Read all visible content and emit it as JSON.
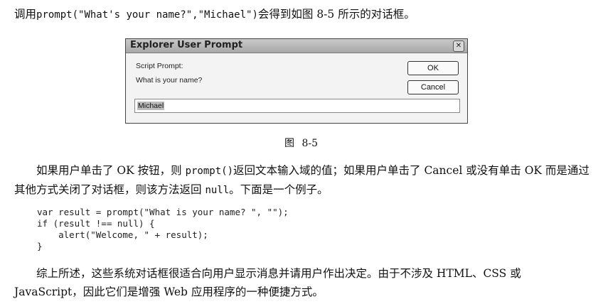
{
  "intro": {
    "prefix": "调用",
    "call": "prompt(\"What's your name?\",\"Michael\")",
    "suffix": "会得到如图 8-5 所示的对话框。"
  },
  "dialog": {
    "title": "Explorer User Prompt",
    "close_glyph": "✕",
    "script_prompt_label": "Script Prompt:",
    "question": "What is your name?",
    "ok_label": "OK",
    "cancel_label": "Cancel",
    "input_value": "Michael"
  },
  "caption": "图 8-5",
  "para1": {
    "t1": "如果用户单击了 OK 按钮，则 ",
    "c1": "prompt()",
    "t2": "返回文本输入域的值；如果用户单击了 Cancel 或没有单击 OK 而是通过其他方式关闭了对话框，则该方法返回 ",
    "c2": "null",
    "t3": "。下面是一个例子。"
  },
  "code": "var result = prompt(\"What is your name? \", \"\");\nif (result !== null) {\n    alert(\"Welcome, \" + result);\n}",
  "para2": "综上所述，这些系统对话框很适合向用户显示消息并请用户作出决定。由于不涉及 HTML、CSS 或 JavaScript，因此它们是增强 Web 应用程序的一种便捷方式。"
}
